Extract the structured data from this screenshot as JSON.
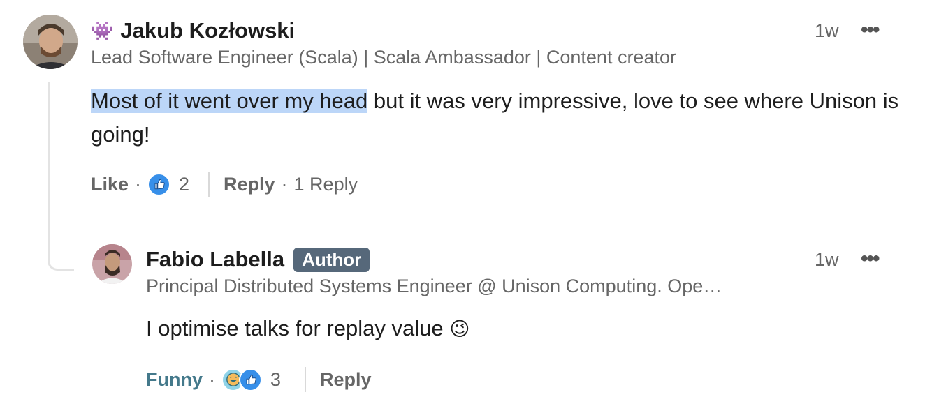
{
  "comment": {
    "emoji": "👾",
    "author": "Jakub Kozłowski",
    "headline": "Lead Software Engineer (Scala) | Scala Ambassador | Content creator",
    "time": "1w",
    "more_icon": "•••",
    "text_highlighted": "Most of it went over my head",
    "text_rest": " but it was very impressive, love to see where Unison is going!",
    "like_label": "Like",
    "dot": "·",
    "reaction_count": "2",
    "reply_label": "Reply",
    "replies_count_label": "1 Reply",
    "colors": {
      "highlight": "#bcd6f8",
      "like_blue": "#378fe9"
    }
  },
  "reply": {
    "author": "Fabio Labella",
    "badge": "Author",
    "headline": "Principal Distributed Systems Engineer @ Unison Computing. Ope…",
    "time": "1w",
    "more_icon": "•••",
    "text": "I optimise talks for replay value",
    "text_emoji": "😉",
    "funny_label": "Funny",
    "dot": "·",
    "reaction_count": "3",
    "reply_label": "Reply",
    "colors": {
      "funny": "#44798b",
      "badge_bg": "#56687a"
    }
  }
}
